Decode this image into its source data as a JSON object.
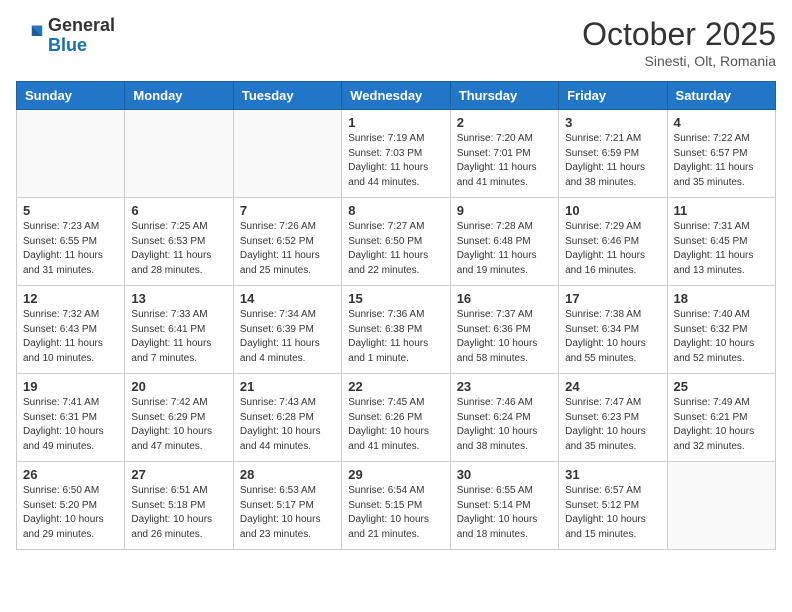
{
  "header": {
    "logo_line1": "General",
    "logo_line2": "Blue",
    "month": "October 2025",
    "location": "Sinesti, Olt, Romania"
  },
  "days_of_week": [
    "Sunday",
    "Monday",
    "Tuesday",
    "Wednesday",
    "Thursday",
    "Friday",
    "Saturday"
  ],
  "weeks": [
    [
      {
        "day": "",
        "info": ""
      },
      {
        "day": "",
        "info": ""
      },
      {
        "day": "",
        "info": ""
      },
      {
        "day": "1",
        "info": "Sunrise: 7:19 AM\nSunset: 7:03 PM\nDaylight: 11 hours and 44 minutes."
      },
      {
        "day": "2",
        "info": "Sunrise: 7:20 AM\nSunset: 7:01 PM\nDaylight: 11 hours and 41 minutes."
      },
      {
        "day": "3",
        "info": "Sunrise: 7:21 AM\nSunset: 6:59 PM\nDaylight: 11 hours and 38 minutes."
      },
      {
        "day": "4",
        "info": "Sunrise: 7:22 AM\nSunset: 6:57 PM\nDaylight: 11 hours and 35 minutes."
      }
    ],
    [
      {
        "day": "5",
        "info": "Sunrise: 7:23 AM\nSunset: 6:55 PM\nDaylight: 11 hours and 31 minutes."
      },
      {
        "day": "6",
        "info": "Sunrise: 7:25 AM\nSunset: 6:53 PM\nDaylight: 11 hours and 28 minutes."
      },
      {
        "day": "7",
        "info": "Sunrise: 7:26 AM\nSunset: 6:52 PM\nDaylight: 11 hours and 25 minutes."
      },
      {
        "day": "8",
        "info": "Sunrise: 7:27 AM\nSunset: 6:50 PM\nDaylight: 11 hours and 22 minutes."
      },
      {
        "day": "9",
        "info": "Sunrise: 7:28 AM\nSunset: 6:48 PM\nDaylight: 11 hours and 19 minutes."
      },
      {
        "day": "10",
        "info": "Sunrise: 7:29 AM\nSunset: 6:46 PM\nDaylight: 11 hours and 16 minutes."
      },
      {
        "day": "11",
        "info": "Sunrise: 7:31 AM\nSunset: 6:45 PM\nDaylight: 11 hours and 13 minutes."
      }
    ],
    [
      {
        "day": "12",
        "info": "Sunrise: 7:32 AM\nSunset: 6:43 PM\nDaylight: 11 hours and 10 minutes."
      },
      {
        "day": "13",
        "info": "Sunrise: 7:33 AM\nSunset: 6:41 PM\nDaylight: 11 hours and 7 minutes."
      },
      {
        "day": "14",
        "info": "Sunrise: 7:34 AM\nSunset: 6:39 PM\nDaylight: 11 hours and 4 minutes."
      },
      {
        "day": "15",
        "info": "Sunrise: 7:36 AM\nSunset: 6:38 PM\nDaylight: 11 hours and 1 minute."
      },
      {
        "day": "16",
        "info": "Sunrise: 7:37 AM\nSunset: 6:36 PM\nDaylight: 10 hours and 58 minutes."
      },
      {
        "day": "17",
        "info": "Sunrise: 7:38 AM\nSunset: 6:34 PM\nDaylight: 10 hours and 55 minutes."
      },
      {
        "day": "18",
        "info": "Sunrise: 7:40 AM\nSunset: 6:32 PM\nDaylight: 10 hours and 52 minutes."
      }
    ],
    [
      {
        "day": "19",
        "info": "Sunrise: 7:41 AM\nSunset: 6:31 PM\nDaylight: 10 hours and 49 minutes."
      },
      {
        "day": "20",
        "info": "Sunrise: 7:42 AM\nSunset: 6:29 PM\nDaylight: 10 hours and 47 minutes."
      },
      {
        "day": "21",
        "info": "Sunrise: 7:43 AM\nSunset: 6:28 PM\nDaylight: 10 hours and 44 minutes."
      },
      {
        "day": "22",
        "info": "Sunrise: 7:45 AM\nSunset: 6:26 PM\nDaylight: 10 hours and 41 minutes."
      },
      {
        "day": "23",
        "info": "Sunrise: 7:46 AM\nSunset: 6:24 PM\nDaylight: 10 hours and 38 minutes."
      },
      {
        "day": "24",
        "info": "Sunrise: 7:47 AM\nSunset: 6:23 PM\nDaylight: 10 hours and 35 minutes."
      },
      {
        "day": "25",
        "info": "Sunrise: 7:49 AM\nSunset: 6:21 PM\nDaylight: 10 hours and 32 minutes."
      }
    ],
    [
      {
        "day": "26",
        "info": "Sunrise: 6:50 AM\nSunset: 5:20 PM\nDaylight: 10 hours and 29 minutes."
      },
      {
        "day": "27",
        "info": "Sunrise: 6:51 AM\nSunset: 5:18 PM\nDaylight: 10 hours and 26 minutes."
      },
      {
        "day": "28",
        "info": "Sunrise: 6:53 AM\nSunset: 5:17 PM\nDaylight: 10 hours and 23 minutes."
      },
      {
        "day": "29",
        "info": "Sunrise: 6:54 AM\nSunset: 5:15 PM\nDaylight: 10 hours and 21 minutes."
      },
      {
        "day": "30",
        "info": "Sunrise: 6:55 AM\nSunset: 5:14 PM\nDaylight: 10 hours and 18 minutes."
      },
      {
        "day": "31",
        "info": "Sunrise: 6:57 AM\nSunset: 5:12 PM\nDaylight: 10 hours and 15 minutes."
      },
      {
        "day": "",
        "info": ""
      }
    ]
  ]
}
